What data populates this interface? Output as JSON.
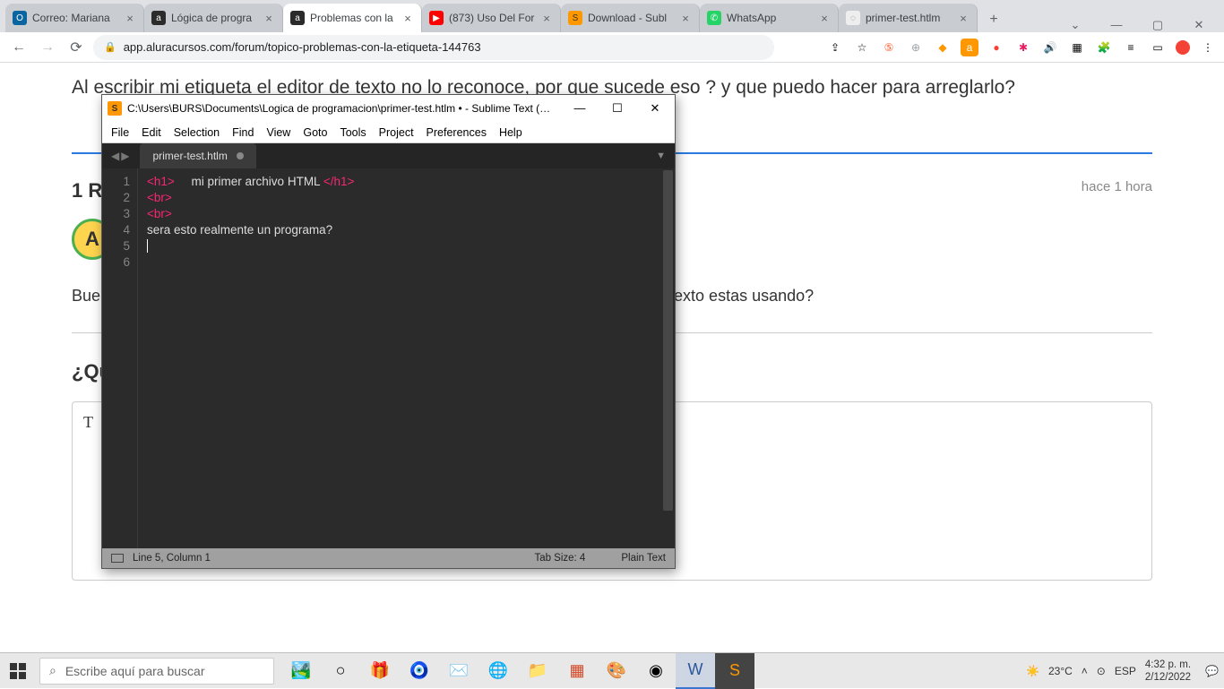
{
  "browser": {
    "tabs": [
      {
        "title": "Correo: Mariana",
        "favicon_bg": "#0a64a0",
        "favicon_txt": "O"
      },
      {
        "title": "Lógica de progra",
        "favicon_bg": "#2b2b2b",
        "favicon_txt": "a"
      },
      {
        "title": "Problemas con la",
        "favicon_bg": "#2b2b2b",
        "favicon_txt": "a",
        "active": true
      },
      {
        "title": "(873) Uso Del For",
        "favicon_bg": "#ff0000",
        "favicon_txt": "▶"
      },
      {
        "title": "Download - Subl",
        "favicon_bg": "#ff9800",
        "favicon_txt": "S"
      },
      {
        "title": "WhatsApp",
        "favicon_bg": "#25d366",
        "favicon_txt": "✆"
      },
      {
        "title": "primer-test.htlm",
        "favicon_bg": "#777",
        "favicon_txt": "◌"
      }
    ],
    "url": "app.aluracursos.com/forum/topico-problemas-con-la-etiqueta-144763"
  },
  "page": {
    "question": "Al escribir mi etiqueta el editor de texto no lo reconoce, por que sucede eso ? y que puedo hacer para arreglarlo?",
    "responses_heading": "1 RE",
    "avatar_letter": "A",
    "timestamp": "hace 1 hora",
    "answer_prefix": "Bue",
    "answer_suffix": "exto estas usando?",
    "prompt_heading": "¿Qu",
    "reply_placeholder": "T"
  },
  "sublime": {
    "title": "C:\\Users\\BURS\\Documents\\Logica de programacion\\primer-test.htlm • - Sublime Text (…",
    "menu": [
      "File",
      "Edit",
      "Selection",
      "Find",
      "View",
      "Goto",
      "Tools",
      "Project",
      "Preferences",
      "Help"
    ],
    "tab_name": "primer-test.htlm",
    "lines": [
      "1",
      "2",
      "3",
      "4",
      "5",
      "6"
    ],
    "code": {
      "l1_a": "<h1>",
      "l1_b": "     mi primer archivo HTML ",
      "l1_c": "</h1>",
      "l2": "<br>",
      "l3": "<br>",
      "l4": "sera esto realmente un programa?"
    },
    "status_left": "Line 5, Column 1",
    "status_mid": "Tab Size: 4",
    "status_right": "Plain Text"
  },
  "taskbar": {
    "search_placeholder": "Escribe aquí para buscar",
    "weather": "23°C",
    "lang": "ESP",
    "time": "4:32 p. m.",
    "date": "2/12/2022"
  }
}
